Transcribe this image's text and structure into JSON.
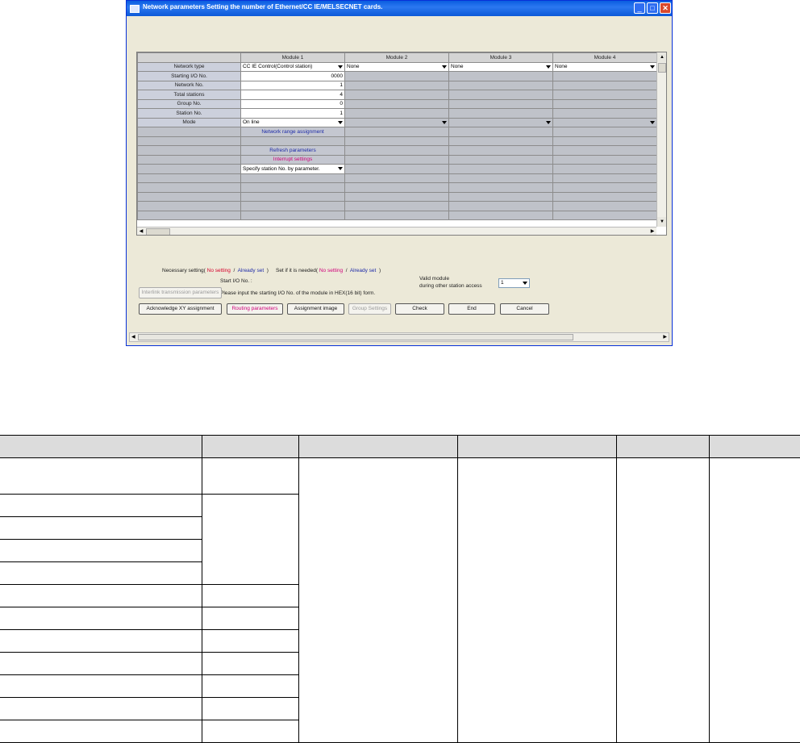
{
  "window": {
    "title": "Network parameters  Setting the number of Ethernet/CC IE/MELSECNET cards."
  },
  "grid": {
    "modules": [
      "Module 1",
      "Module 2",
      "Module 3",
      "Module 4"
    ],
    "labels": {
      "network_type": "Network type",
      "starting_io": "Starting I/O No.",
      "network_no": "Network No.",
      "total_stations": "Total stations",
      "group_no": "Group No.",
      "station_no": "Station No.",
      "mode": "Mode"
    },
    "module1": {
      "network_type": "CC IE Control(Control station)",
      "starting_io": "0000",
      "network_no": "1",
      "total_stations": "4",
      "group_no": "0",
      "station_no": "1",
      "mode": "On line",
      "network_range": "Network range assignment",
      "refresh": "Refresh parameters",
      "interrupt": "Interrupt settings",
      "specify_station": "Specify station No. by parameter."
    },
    "other_network_type": "None"
  },
  "legend": {
    "necessary": "Necessary setting(",
    "no_setting": "No setting",
    "slash": "/",
    "already_set": "Already set",
    "close_paren": ")",
    "set_if_needed": "Set if it is needed(",
    "no_setting2": "No setting",
    "slash2": "/",
    "already_set2": "Already set",
    "close_paren2": ")"
  },
  "info": {
    "start_io_label": "Start I/O No. :",
    "hint": "Please input the starting I/O No. of the module in HEX(16 bit) form.",
    "valid_module_label1": "Valid module",
    "valid_module_label2": "during other station access",
    "valid_module_value": "1"
  },
  "buttons": {
    "interlink": "Interlink transmission parameters",
    "acknowledge": "Acknowledge XY assignment",
    "routing": "Routing parameters",
    "assignment_image": "Assignment image",
    "group_settings": "Group Settings",
    "check": "Check",
    "end": "End",
    "cancel": "Cancel"
  }
}
